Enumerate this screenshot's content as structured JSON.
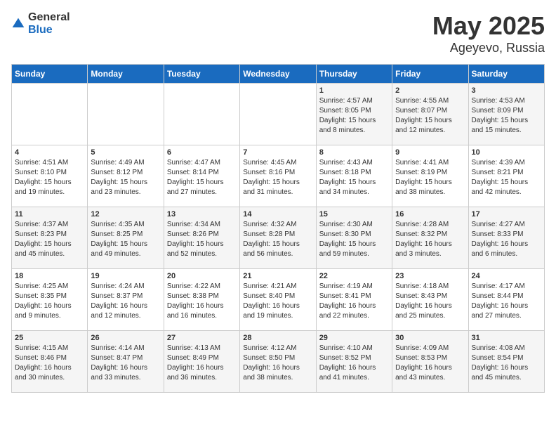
{
  "header": {
    "logo_general": "General",
    "logo_blue": "Blue",
    "title": "May 2025",
    "location": "Ageyevo, Russia"
  },
  "days_of_week": [
    "Sunday",
    "Monday",
    "Tuesday",
    "Wednesday",
    "Thursday",
    "Friday",
    "Saturday"
  ],
  "weeks": [
    [
      {
        "day": "",
        "info": ""
      },
      {
        "day": "",
        "info": ""
      },
      {
        "day": "",
        "info": ""
      },
      {
        "day": "",
        "info": ""
      },
      {
        "day": "1",
        "info": "Sunrise: 4:57 AM\nSunset: 8:05 PM\nDaylight: 15 hours\nand 8 minutes."
      },
      {
        "day": "2",
        "info": "Sunrise: 4:55 AM\nSunset: 8:07 PM\nDaylight: 15 hours\nand 12 minutes."
      },
      {
        "day": "3",
        "info": "Sunrise: 4:53 AM\nSunset: 8:09 PM\nDaylight: 15 hours\nand 15 minutes."
      }
    ],
    [
      {
        "day": "4",
        "info": "Sunrise: 4:51 AM\nSunset: 8:10 PM\nDaylight: 15 hours\nand 19 minutes."
      },
      {
        "day": "5",
        "info": "Sunrise: 4:49 AM\nSunset: 8:12 PM\nDaylight: 15 hours\nand 23 minutes."
      },
      {
        "day": "6",
        "info": "Sunrise: 4:47 AM\nSunset: 8:14 PM\nDaylight: 15 hours\nand 27 minutes."
      },
      {
        "day": "7",
        "info": "Sunrise: 4:45 AM\nSunset: 8:16 PM\nDaylight: 15 hours\nand 31 minutes."
      },
      {
        "day": "8",
        "info": "Sunrise: 4:43 AM\nSunset: 8:18 PM\nDaylight: 15 hours\nand 34 minutes."
      },
      {
        "day": "9",
        "info": "Sunrise: 4:41 AM\nSunset: 8:19 PM\nDaylight: 15 hours\nand 38 minutes."
      },
      {
        "day": "10",
        "info": "Sunrise: 4:39 AM\nSunset: 8:21 PM\nDaylight: 15 hours\nand 42 minutes."
      }
    ],
    [
      {
        "day": "11",
        "info": "Sunrise: 4:37 AM\nSunset: 8:23 PM\nDaylight: 15 hours\nand 45 minutes."
      },
      {
        "day": "12",
        "info": "Sunrise: 4:35 AM\nSunset: 8:25 PM\nDaylight: 15 hours\nand 49 minutes."
      },
      {
        "day": "13",
        "info": "Sunrise: 4:34 AM\nSunset: 8:26 PM\nDaylight: 15 hours\nand 52 minutes."
      },
      {
        "day": "14",
        "info": "Sunrise: 4:32 AM\nSunset: 8:28 PM\nDaylight: 15 hours\nand 56 minutes."
      },
      {
        "day": "15",
        "info": "Sunrise: 4:30 AM\nSunset: 8:30 PM\nDaylight: 15 hours\nand 59 minutes."
      },
      {
        "day": "16",
        "info": "Sunrise: 4:28 AM\nSunset: 8:32 PM\nDaylight: 16 hours\nand 3 minutes."
      },
      {
        "day": "17",
        "info": "Sunrise: 4:27 AM\nSunset: 8:33 PM\nDaylight: 16 hours\nand 6 minutes."
      }
    ],
    [
      {
        "day": "18",
        "info": "Sunrise: 4:25 AM\nSunset: 8:35 PM\nDaylight: 16 hours\nand 9 minutes."
      },
      {
        "day": "19",
        "info": "Sunrise: 4:24 AM\nSunset: 8:37 PM\nDaylight: 16 hours\nand 12 minutes."
      },
      {
        "day": "20",
        "info": "Sunrise: 4:22 AM\nSunset: 8:38 PM\nDaylight: 16 hours\nand 16 minutes."
      },
      {
        "day": "21",
        "info": "Sunrise: 4:21 AM\nSunset: 8:40 PM\nDaylight: 16 hours\nand 19 minutes."
      },
      {
        "day": "22",
        "info": "Sunrise: 4:19 AM\nSunset: 8:41 PM\nDaylight: 16 hours\nand 22 minutes."
      },
      {
        "day": "23",
        "info": "Sunrise: 4:18 AM\nSunset: 8:43 PM\nDaylight: 16 hours\nand 25 minutes."
      },
      {
        "day": "24",
        "info": "Sunrise: 4:17 AM\nSunset: 8:44 PM\nDaylight: 16 hours\nand 27 minutes."
      }
    ],
    [
      {
        "day": "25",
        "info": "Sunrise: 4:15 AM\nSunset: 8:46 PM\nDaylight: 16 hours\nand 30 minutes."
      },
      {
        "day": "26",
        "info": "Sunrise: 4:14 AM\nSunset: 8:47 PM\nDaylight: 16 hours\nand 33 minutes."
      },
      {
        "day": "27",
        "info": "Sunrise: 4:13 AM\nSunset: 8:49 PM\nDaylight: 16 hours\nand 36 minutes."
      },
      {
        "day": "28",
        "info": "Sunrise: 4:12 AM\nSunset: 8:50 PM\nDaylight: 16 hours\nand 38 minutes."
      },
      {
        "day": "29",
        "info": "Sunrise: 4:10 AM\nSunset: 8:52 PM\nDaylight: 16 hours\nand 41 minutes."
      },
      {
        "day": "30",
        "info": "Sunrise: 4:09 AM\nSunset: 8:53 PM\nDaylight: 16 hours\nand 43 minutes."
      },
      {
        "day": "31",
        "info": "Sunrise: 4:08 AM\nSunset: 8:54 PM\nDaylight: 16 hours\nand 45 minutes."
      }
    ]
  ]
}
